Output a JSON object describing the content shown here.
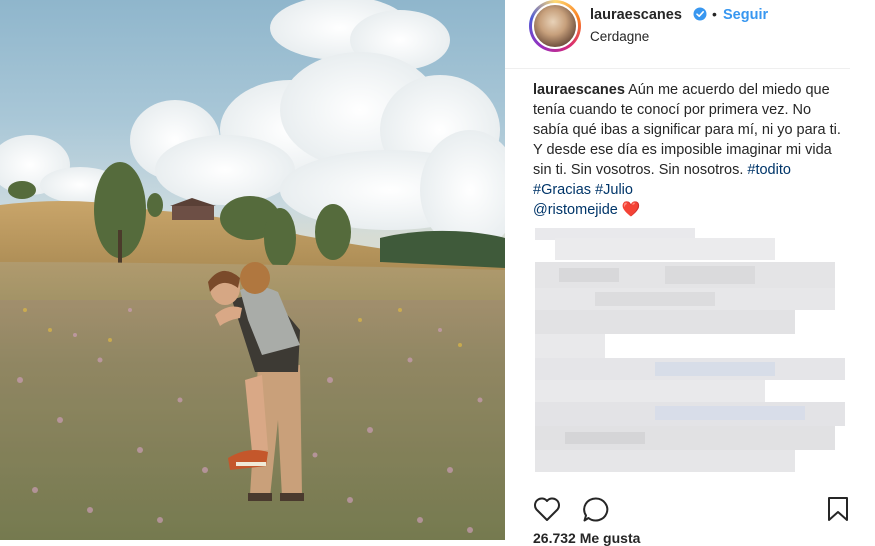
{
  "post": {
    "username": "lauraescanes",
    "follow_label": "Seguir",
    "location": "Cerdagne",
    "caption": {
      "username": "lauraescanes",
      "text": "Aún me acuerdo del miedo que tenía cuando te conocí por primera vez. No sabía qué ibas a significar para mí, ni yo para ti. Y desde ese día es imposible imaginar mi vida sin ti. Sin vosotros. Sin nosotros.",
      "hashtags": [
        "#todito",
        "#Gracias",
        "#Julio"
      ],
      "mention": "@ristomejide",
      "emoji": "❤️"
    },
    "likes_text": "26.732 Me gusta",
    "photo": {
      "description_icon": "photo-field-piggyback"
    }
  },
  "icons": {
    "verified": "verified-badge-icon",
    "like": "heart-icon",
    "comment": "comment-icon",
    "save": "bookmark-icon"
  },
  "colors": {
    "link": "#3897f0",
    "hashtag": "#003569",
    "text": "#262626",
    "divider": "#efefef",
    "heart_emoji": "#ed1c24"
  }
}
